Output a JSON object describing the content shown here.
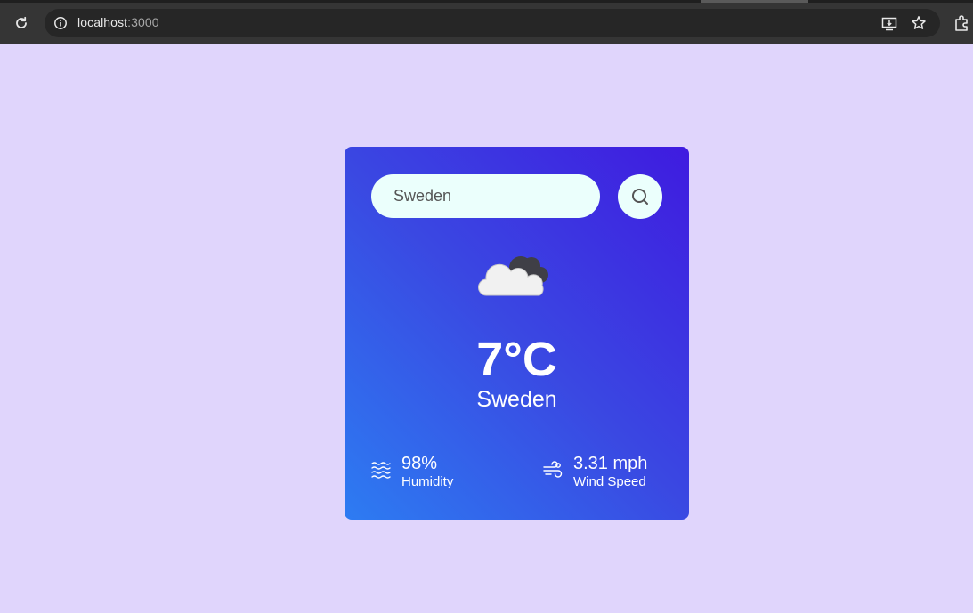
{
  "browser": {
    "url_host": "localhost",
    "url_port": ":3000"
  },
  "search": {
    "value": "Sweden",
    "placeholder": "Sweden"
  },
  "weather": {
    "icon": "cloud-icon",
    "temperature": "7°C",
    "city": "Sweden",
    "humidity_value": "98%",
    "humidity_label": "Humidity",
    "wind_value": "3.31 mph",
    "wind_label": "Wind Speed"
  },
  "colors": {
    "page_background": "#e0d5fc",
    "card_gradient_start": "#2d7cf2",
    "card_gradient_end": "#3f1be0",
    "search_background": "#ebfffc"
  }
}
